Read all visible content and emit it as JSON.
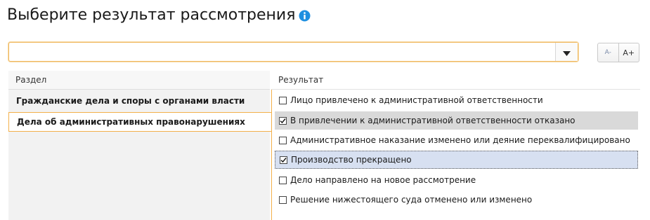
{
  "header": {
    "title": "Выберите результат рассмотрения",
    "info_icon": "info-icon"
  },
  "combo": {
    "value": "",
    "dropdown_icon": "triangle-down-icon"
  },
  "font_controls": {
    "decrease_label": "A-",
    "increase_label": "A+"
  },
  "sections": {
    "header": "Раздел",
    "items": [
      {
        "label": "Гражданские дела и споры с органами власти",
        "active": false
      },
      {
        "label": "Дела об административных правонарушениях",
        "active": true
      }
    ]
  },
  "results": {
    "header": "Результат",
    "items": [
      {
        "label": "Лицо привлечено к административной ответственности",
        "checked": false
      },
      {
        "label": "В привлечении к административной ответственности отказано",
        "checked": true
      },
      {
        "label": "Административное наказание изменено или деяние переквалифицировано",
        "checked": false
      },
      {
        "label": "Производство прекращено",
        "checked": true
      },
      {
        "label": "Дело направлено на новое рассмотрение",
        "checked": false
      },
      {
        "label": "Решение нижестоящего суда отменено или изменено",
        "checked": false
      }
    ]
  },
  "colors": {
    "accent_border": "#f3b04a",
    "info_blue": "#1e8fe0",
    "selected_row": "#d9d9d9",
    "focused_row": "#d7e0f1"
  }
}
